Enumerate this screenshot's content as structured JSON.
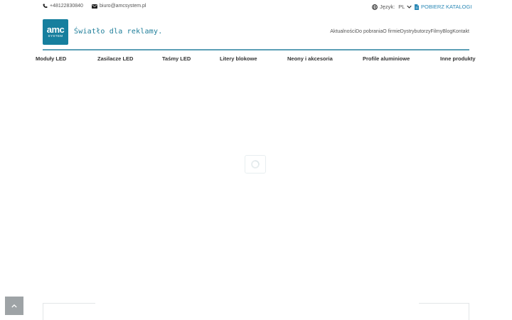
{
  "topbar": {
    "phone": "+48122830840",
    "email": "biuro@amcsystem.pl",
    "language_label": "Język:",
    "language_value": "PL",
    "catalog_label": "POBIERZ KATALOGI",
    "icons": {
      "phone": "phone-icon",
      "email": "envelope-icon",
      "globe": "globe-icon",
      "chevron": "chevron-down-icon",
      "file": "file-icon"
    }
  },
  "header": {
    "logo_main": "amc",
    "logo_sub": "SYSTEM",
    "tagline": "Światło dla reklamy.",
    "nav": [
      "Aktualności",
      "Do pobrania",
      "O firmie",
      "Dystrybutorzy",
      "Filmy",
      "Blog",
      "Kontakt"
    ]
  },
  "categories": [
    "Moduły LED",
    "Zasilacze LED",
    "Taśmy LED",
    "Litery blokowe",
    "Neony i akcesoria",
    "Profile aluminiowe",
    "Inne produkty"
  ],
  "colors": {
    "brand": "#167f9e",
    "accent": "#2a88b5",
    "rule": "#5c9fb6"
  }
}
